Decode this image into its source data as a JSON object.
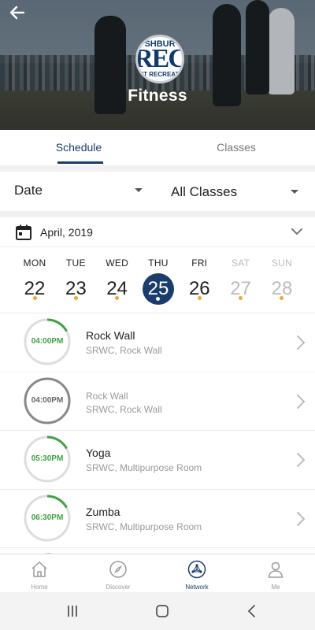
{
  "header": {
    "title": "Fitness",
    "logo": {
      "text": "REC",
      "top_text": "SHBUR",
      "bottom_text": "NT RECREATI"
    }
  },
  "tabs": [
    {
      "label": "Schedule",
      "active": true
    },
    {
      "label": "Classes",
      "active": false
    }
  ],
  "filters": {
    "date_label": "Date",
    "class_label": "All Classes"
  },
  "calendar": {
    "month_label": "April,  2019",
    "days": [
      {
        "dow": "MON",
        "num": "22",
        "dot": true,
        "weekend": false,
        "selected": false
      },
      {
        "dow": "TUE",
        "num": "23",
        "dot": true,
        "weekend": false,
        "selected": false
      },
      {
        "dow": "WED",
        "num": "24",
        "dot": true,
        "weekend": false,
        "selected": false
      },
      {
        "dow": "THU",
        "num": "25",
        "dot": true,
        "weekend": false,
        "selected": true
      },
      {
        "dow": "FRI",
        "num": "26",
        "dot": true,
        "weekend": false,
        "selected": false
      },
      {
        "dow": "SAT",
        "num": "27",
        "dot": true,
        "weekend": true,
        "selected": false
      },
      {
        "dow": "SUN",
        "num": "28",
        "dot": true,
        "weekend": true,
        "selected": false
      }
    ]
  },
  "classes": [
    {
      "time": "04:00PM",
      "name": "Rock Wall",
      "location": "SRWC, Rock Wall",
      "progress": 0.17,
      "past": false
    },
    {
      "time": "04:00PM",
      "name": "Rock Wall",
      "location": "SRWC, Rock Wall",
      "progress": 1.0,
      "past": true
    },
    {
      "time": "05:30PM",
      "name": "Yoga",
      "location": "SRWC, Multipurpose Room",
      "progress": 0.17,
      "past": false
    },
    {
      "time": "06:30PM",
      "name": "Zumba",
      "location": "SRWC, Multipurpose Room",
      "progress": 0.17,
      "past": false
    }
  ],
  "bottom_nav": [
    {
      "label": "Home",
      "icon": "home-icon",
      "active": false
    },
    {
      "label": "Discover",
      "icon": "compass-icon",
      "active": false
    },
    {
      "label": "Network",
      "icon": "network-icon",
      "active": true
    },
    {
      "label": "Me",
      "icon": "person-icon",
      "active": false
    }
  ],
  "colors": {
    "primary": "#1a3d6b",
    "accent_green": "#3fa243",
    "event_dot": "#e8a93a",
    "muted": "#999999"
  }
}
